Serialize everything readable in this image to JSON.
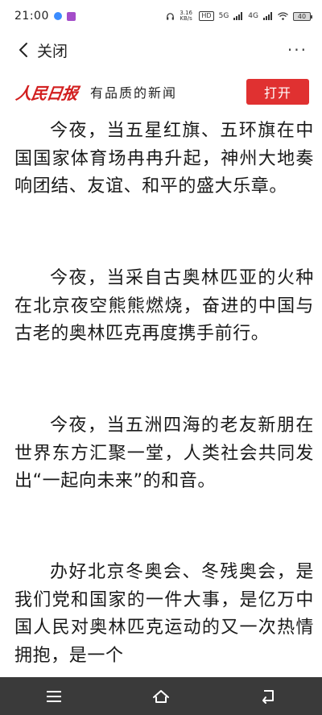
{
  "status_bar": {
    "time": "21:00",
    "speed": "3.16 KB/s",
    "hd": "HD",
    "network_5g": "5G",
    "network_4g": "4G",
    "battery": "40"
  },
  "nav": {
    "close_label": "关闭",
    "more_label": "···"
  },
  "banner": {
    "brand": "人民日报",
    "slogan": "有品质的新闻",
    "open_label": "打开"
  },
  "article": {
    "paragraphs": [
      "今夜，当五星红旗、五环旗在中国国家体育场冉冉升起，神州大地奏响团结、友谊、和平的盛大乐章。",
      "今夜，当采自古奥林匹亚的火种在北京夜空熊熊燃烧，奋进的中国与古老的奥林匹克再度携手前行。",
      "今夜，当五洲四海的老友新朋在世界东方汇聚一堂，人类社会共同发出“一起向未来”的和音。",
      "办好北京冬奥会、冬残奥会，是我们党和国家的一件大事，是亿万中国人民对奥林匹克运动的又一次热情拥抱，是一个"
    ]
  },
  "colors": {
    "brand_red": "#d21f1f",
    "button_red": "#e03131",
    "system_nav_bg": "#3a3a3a"
  }
}
